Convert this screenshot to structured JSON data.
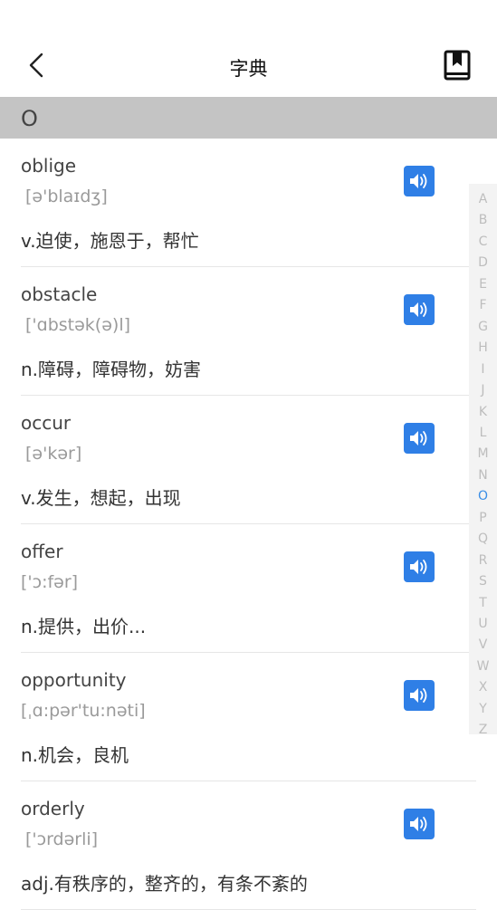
{
  "header": {
    "title": "字典"
  },
  "section": {
    "letter": "O"
  },
  "words": [
    {
      "word": "oblige",
      "phonetic": "[ə'blaɪdʒ]",
      "definition": "v.迫使，施恩于，帮忙",
      "indent": true
    },
    {
      "word": "obstacle",
      "phonetic": "['ɑbstək(ə)l]",
      "definition": "n.障碍，障碍物，妨害",
      "indent": true
    },
    {
      "word": "occur",
      "phonetic": "[ə'kər]",
      "definition": "v.发生，想起，出现",
      "indent": true
    },
    {
      "word": "offer",
      "phonetic": "['ɔ:fər]",
      "definition": "n.提供，出价...",
      "indent": false
    },
    {
      "word": "opportunity",
      "phonetic": "[ˌɑ:pər'tu:nəti]",
      "definition": "n.机会，良机",
      "indent": false
    },
    {
      "word": "orderly",
      "phonetic": "['ɔrdərli]",
      "definition": "adj.有秩序的，整齐的，有条不紊的",
      "indent": true
    }
  ],
  "index": {
    "letters": [
      "A",
      "B",
      "C",
      "D",
      "E",
      "F",
      "G",
      "H",
      "I",
      "J",
      "K",
      "L",
      "M",
      "N",
      "O",
      "P",
      "Q",
      "R",
      "S",
      "T",
      "U",
      "V",
      "W",
      "X",
      "Y",
      "Z"
    ],
    "active": "O"
  },
  "colors": {
    "accent": "#2f7fe6",
    "section_bg": "#c4c4c4",
    "index_active": "#3a8ee6"
  },
  "icons": {
    "back": "chevron-left-icon",
    "bookmark": "bookmark-book-icon",
    "speaker": "speaker-icon"
  }
}
